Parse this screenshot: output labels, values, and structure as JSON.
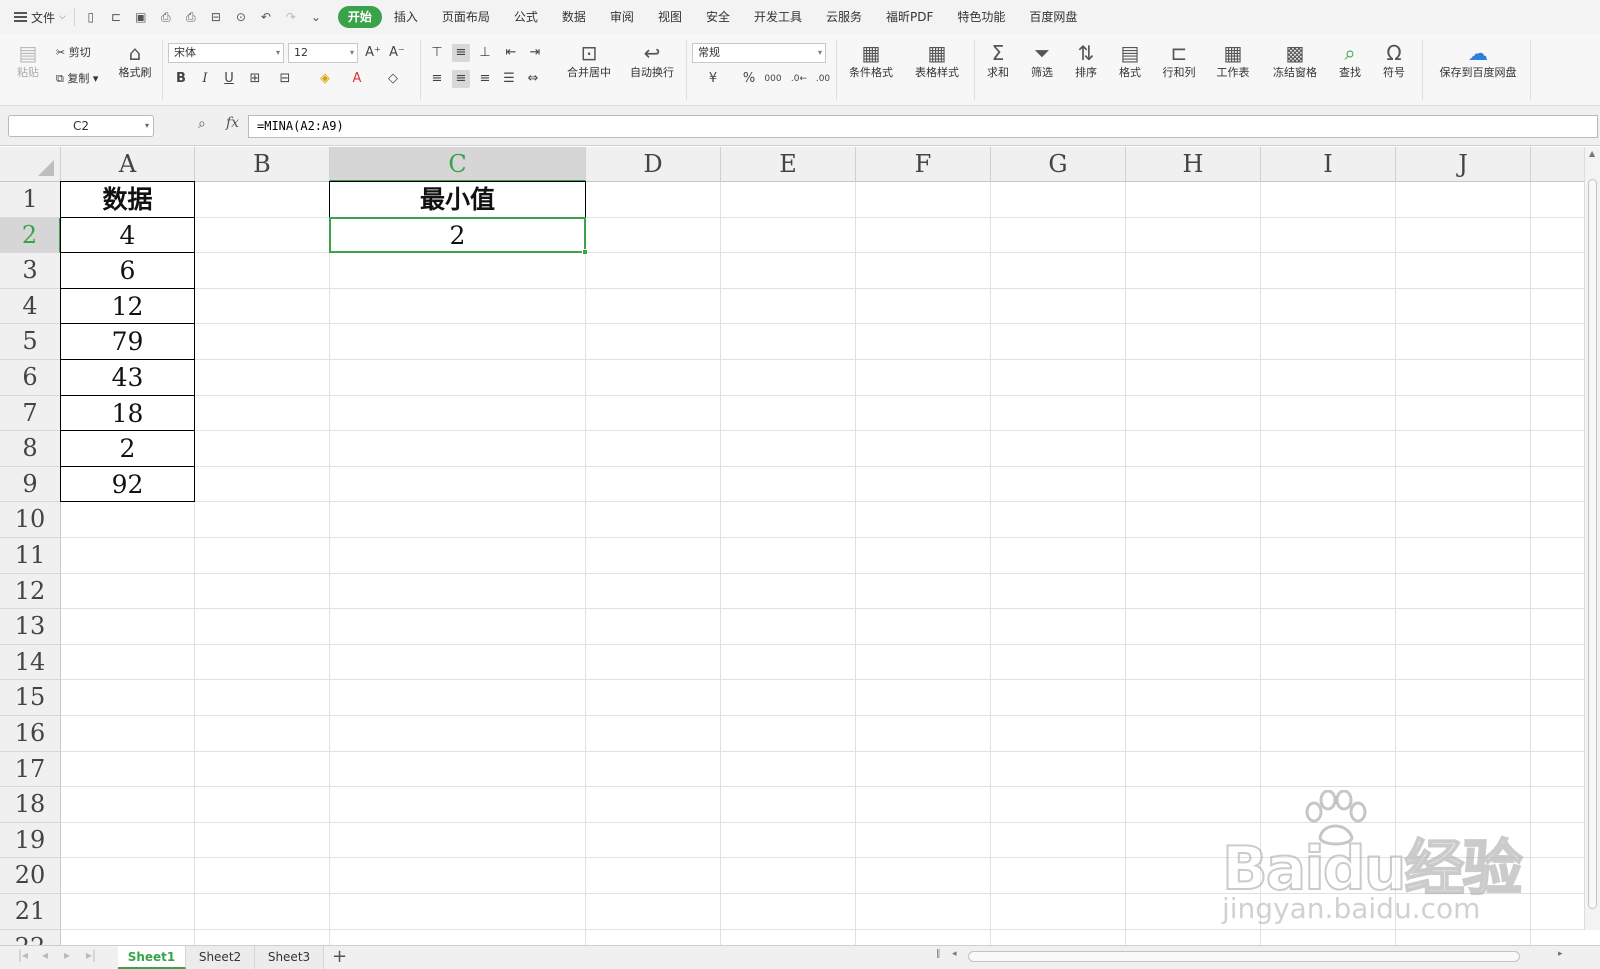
{
  "menubar": {
    "file_label": "文件",
    "tabs": [
      "开始",
      "插入",
      "页面布局",
      "公式",
      "数据",
      "审阅",
      "视图",
      "安全",
      "开发工具",
      "云服务",
      "福昕PDF",
      "特色功能",
      "百度网盘"
    ],
    "active_tab": "开始"
  },
  "ribbon": {
    "paste": "粘贴",
    "cut": "剪切",
    "copy": "复制",
    "format_painter": "格式刷",
    "font_name": "宋体",
    "font_size": "12",
    "merge_center": "合并居中",
    "wrap_text": "自动换行",
    "number_format": "常规",
    "conditional_format": "条件格式",
    "table_style": "表格样式",
    "sum": "求和",
    "filter": "筛选",
    "sort": "排序",
    "format": "格式",
    "rows_cols": "行和列",
    "worksheet": "工作表",
    "freeze": "冻结窗格",
    "find": "查找",
    "symbol": "符号",
    "save_baidu": "保存到百度网盘"
  },
  "formula_bar": {
    "name_box": "C2",
    "fx": "fx",
    "formula": "=MINA(A2:A9)"
  },
  "sheet": {
    "columns": [
      "A",
      "B",
      "C",
      "D",
      "E",
      "F",
      "G",
      "H",
      "I",
      "J"
    ],
    "rows": [
      "1",
      "2",
      "3",
      "4",
      "5",
      "6",
      "7",
      "8",
      "9",
      "10",
      "11",
      "12",
      "13",
      "14",
      "15",
      "16",
      "17",
      "18",
      "19",
      "20",
      "21",
      "22"
    ],
    "selected_cell": "C2",
    "cells": {
      "A1": "数据",
      "A2": "4",
      "A3": "6",
      "A4": "12",
      "A5": "79",
      "A6": "43",
      "A7": "18",
      "A8": "2",
      "A9": "92",
      "C1": "最小值",
      "C2": "2"
    }
  },
  "sheet_tabs": [
    "Sheet1",
    "Sheet2",
    "Sheet3"
  ],
  "active_sheet": "Sheet1",
  "watermark": {
    "brand": "Baidu经验",
    "url": "jingyan.baidu.com"
  },
  "colors": {
    "accent": "#3aa34a",
    "grid": "#e1e1e1"
  }
}
